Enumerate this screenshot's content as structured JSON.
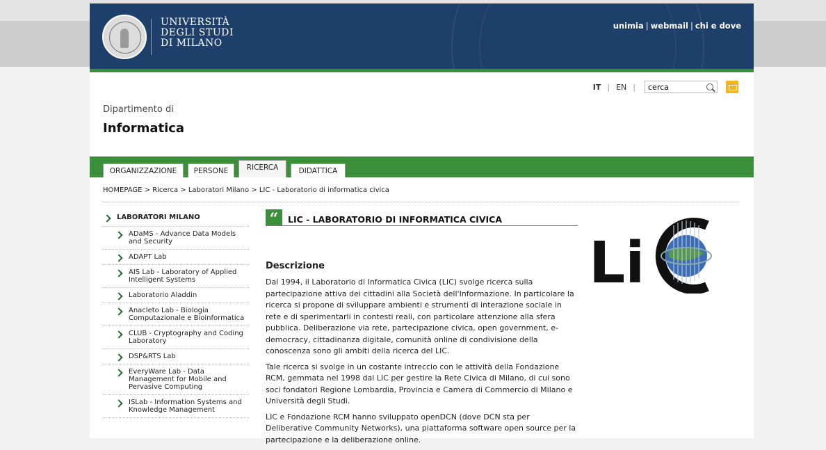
{
  "university": {
    "line1": "UNIVERSITÀ",
    "line2": "DEGLI STUDI",
    "line3": "DI MILANO"
  },
  "toplinks": {
    "unimia": "unimia",
    "webmail": "webmail",
    "chi": "chi e dove",
    "sep": "|"
  },
  "lang": {
    "it": "IT",
    "en": "EN",
    "sep": "|"
  },
  "search": {
    "value": "cerca"
  },
  "dept": {
    "small": "Dipartimento di",
    "big": "Informatica"
  },
  "nav": {
    "tabs": [
      "ORGANIZZAZIONE",
      "PERSONE",
      "RICERCA",
      "DIDATTICA"
    ],
    "active": "RICERCA"
  },
  "breadcrumb": "HOMEPAGE > Ricerca > Laboratori Milano > LIC - Laboratorio di informatica civica",
  "sidebar": {
    "heading": "LABORATORI MILANO",
    "items": [
      {
        "label": "ADaMS - Advance Data Models and Security"
      },
      {
        "label": "ADAPT Lab"
      },
      {
        "label": "AIS Lab - Laboratory of Applied Intelligent Systems"
      },
      {
        "label": "Laboratorio Aladdin"
      },
      {
        "label": "Anacleto Lab - Biologia Computazionale e Bioinformatica"
      },
      {
        "label": "CLUB - Cryptography and Coding Laboratory"
      },
      {
        "label": "DSP&RTS Lab"
      },
      {
        "label": "EveryWare Lab - Data Management for Mobile and Pervasive Computing"
      },
      {
        "label": "ISLab - Information Systems and Knowledge Management"
      }
    ]
  },
  "content": {
    "quote_mark": "“",
    "title": "LIC - LABORATORIO DI INFORMATICA CIVICA",
    "desc_heading": "Descrizione",
    "paragraphs": [
      "Dal 1994, il Laboratorio di Informatica Civica (LIC) svolge ricerca sulla partecipazione attiva dei cittadini alla Società dell'Informazione.  In particolare la ricerca si propone di sviluppare ambienti e strumenti di interazione sociale in rete e di sperimentarli in contesti reali, con particolare attenzione alla sfera pubblica. Deliberazione via rete, partecipazione civica, open government, e-democracy,  cittadinanza digitale, comunità online di condivisione della conoscenza sono gli ambiti della ricerca del LIC.",
      "Tale ricerca si svolge in un costante intreccio con le attività della Fondazione RCM, gemmata nel 1998 dal LIC per gestire la Rete Civica di Milano, di cui sono soci fondatori Regione Lombardia, Provincia e Camera di Commercio di Milano e Università degli Studi.",
      "LIC e Fondazione RCM hanno sviluppato openDCN (dove DCN sta per  Deliberative Community Networks), una piattaforma software open source per la partecipazione e la deliberazione online."
    ]
  },
  "logo": {
    "text": "Li"
  },
  "colors": {
    "navy": "#1f3f6b",
    "green": "#3c8f3a",
    "rss": "#f4b422"
  }
}
